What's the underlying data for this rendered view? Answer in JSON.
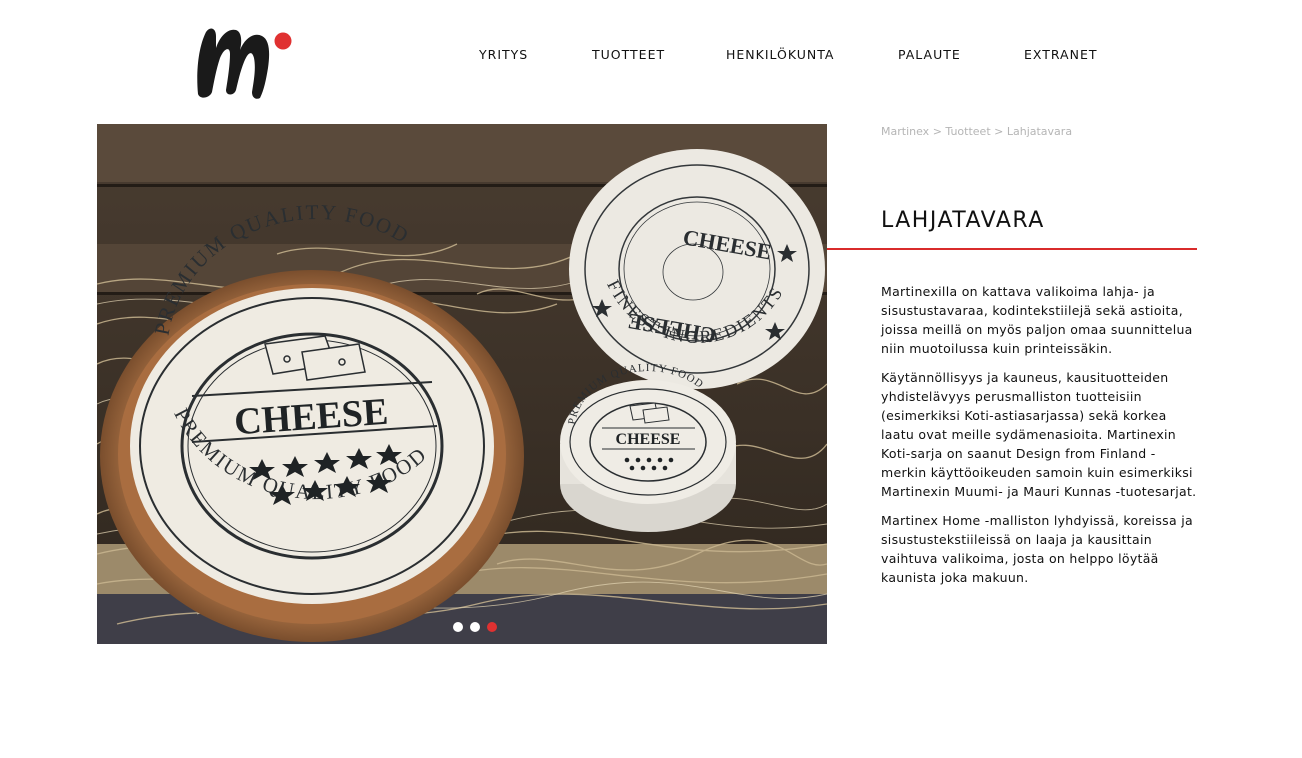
{
  "brand": {
    "logo_letter": "m",
    "accent_color": "#e03131"
  },
  "nav": {
    "items": [
      {
        "label": "YRITYS"
      },
      {
        "label": "TUOTTEET"
      },
      {
        "label": "HENKILÖKUNTA"
      },
      {
        "label": "PALAUTE"
      },
      {
        "label": "EXTRANET"
      }
    ]
  },
  "hero": {
    "image_text": {
      "premium_quality_food": "PREMIUM QUALITY FOOD",
      "cheese": "CHEESE",
      "finest_ingredients": "FINEST INGREDIENTS"
    },
    "slides_count": 3,
    "active_slide": 3
  },
  "breadcrumb": {
    "items": [
      {
        "label": "Martinex"
      },
      {
        "label": "Tuotteet"
      },
      {
        "label": "Lahjatavara"
      }
    ],
    "separator": ">"
  },
  "page": {
    "title": "LAHJATAVARA",
    "paragraphs": [
      "Martinexilla on kattava valikoima lahja- ja sisustustavaraa, kodintekstiilejä sekä astioita, joissa meillä on myös paljon omaa suunnittelua niin muotoilussa kuin printeissäkin.",
      "Käytännöllisyys ja kauneus, kausituotteiden yhdistelävyys perusmalliston tuotteisiin (esimerkiksi Koti-astiasarjassa) sekä korkea laatu ovat meille sydämenasioita. Martinexin Koti-sarja on saanut Design from Finland -merkin käyttöoikeuden samoin kuin esimerkiksi Martinexin Muumi- ja Mauri Kunnas -tuotesarjat.",
      "Martinex Home -malliston lyhdyissä, koreissa ja sisustustekstiileissä on laaja ja kausittain vaihtuva valikoima, josta on helppo löytää kaunista joka makuun."
    ]
  }
}
